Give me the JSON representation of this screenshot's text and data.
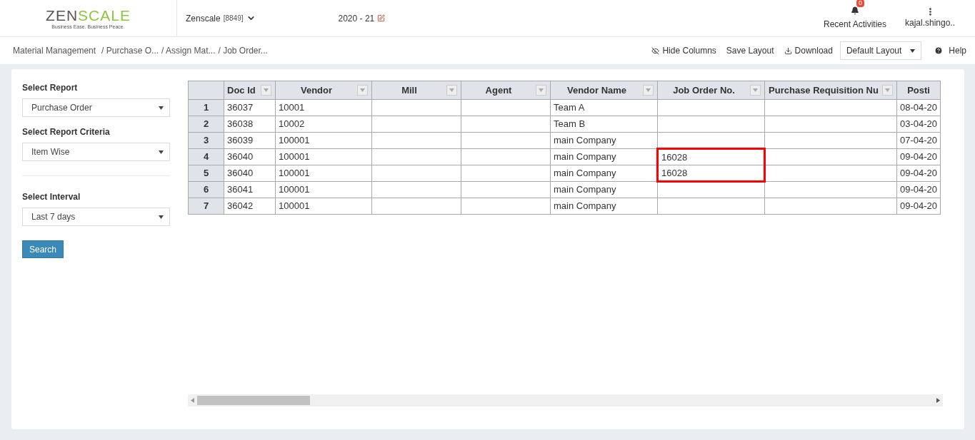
{
  "logo": {
    "first": "ZEN",
    "second": "SCALE",
    "tagline": "Business Ease. Business Peace."
  },
  "company": {
    "name": "Zenscale",
    "code": "[8849]"
  },
  "fiscal_year": "2020 - 21",
  "notifications": {
    "count": "0",
    "label": "Recent Activities"
  },
  "user": {
    "name": "kajal.shingo.."
  },
  "breadcrumb": [
    "Material Management",
    "/ Purchase O...",
    "/ Assign Mat...",
    "/ Job Order..."
  ],
  "toolbar": {
    "hide_columns": "Hide Columns",
    "save_layout": "Save Layout",
    "download": "Download",
    "layout_select": "Default Layout",
    "help": "Help"
  },
  "filters": [
    {
      "label": "Select Report",
      "value": "Purchase Order"
    },
    {
      "label": "Select Report Criteria",
      "value": "Item Wise"
    },
    {
      "label": "Select Interval",
      "value": "Last 7 days"
    }
  ],
  "search_button": "Search",
  "table": {
    "columns": [
      {
        "label": "Doc Id",
        "filter": true
      },
      {
        "label": "Vendor",
        "filter": true
      },
      {
        "label": "Mill",
        "filter": true
      },
      {
        "label": "Agent",
        "filter": true
      },
      {
        "label": "Vendor Name",
        "filter": true
      },
      {
        "label": "Job Order No.",
        "filter": true
      },
      {
        "label": "Purchase Requisition Nu",
        "filter": true
      },
      {
        "label": "Posti",
        "filter": false
      }
    ],
    "rows": [
      {
        "number": "1",
        "cells": [
          "36037",
          "10001",
          "",
          "",
          "Team A",
          "",
          "",
          "08-04-20"
        ],
        "highlighted": false
      },
      {
        "number": "2",
        "cells": [
          "36038",
          "10002",
          "",
          "",
          "Team B",
          "",
          "",
          "03-04-20"
        ],
        "highlighted": false
      },
      {
        "number": "3",
        "cells": [
          "36039",
          "100001",
          "",
          "",
          "main Company",
          "",
          "",
          "07-04-20"
        ],
        "highlighted": false
      },
      {
        "number": "4",
        "cells": [
          "36040",
          "100001",
          "",
          "",
          "main Company",
          "16028",
          "",
          "09-04-20"
        ],
        "highlighted": true
      },
      {
        "number": "5",
        "cells": [
          "36040",
          "100001",
          "",
          "",
          "main Company",
          "16028",
          "",
          "09-04-20"
        ],
        "highlighted": true
      },
      {
        "number": "6",
        "cells": [
          "36041",
          "100001",
          "",
          "",
          "main Company",
          "",
          "",
          "09-04-20"
        ],
        "highlighted": false
      },
      {
        "number": "7",
        "cells": [
          "36042",
          "100001",
          "",
          "",
          "main Company",
          "",
          "",
          "09-04-20"
        ],
        "highlighted": false
      }
    ]
  }
}
